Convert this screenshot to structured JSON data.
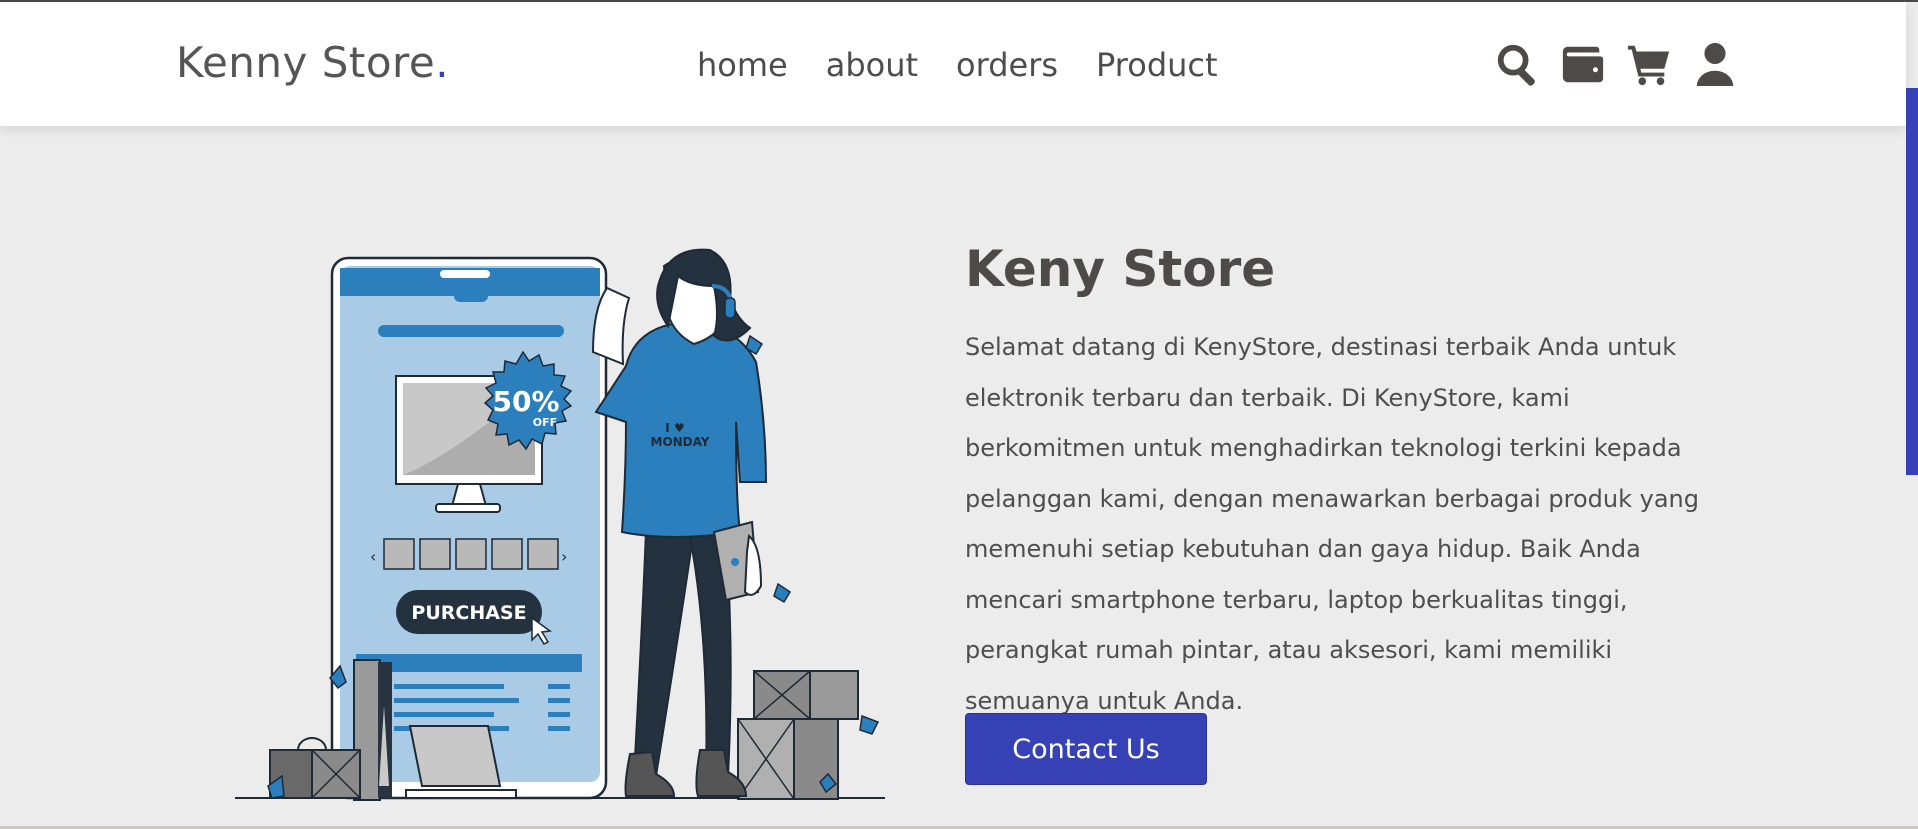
{
  "nav": {
    "logo_text": "Kenny Store",
    "logo_dot": ".",
    "links": [
      "home",
      "about",
      "orders",
      "Product"
    ],
    "icons": [
      "search-icon",
      "wallet-icon",
      "cart-icon",
      "user-icon"
    ]
  },
  "hero": {
    "title": "Keny Store",
    "description": "Selamat datang di KenyStore, destinasi terbaik Anda untuk elektronik terbaru dan terbaik. Di KenyStore, kami berkomitmen untuk menghadirkan teknologi terkini kepada pelanggan kami, dengan menawarkan berbagai produk yang memenuhi setiap kebutuhan dan gaya hidup. Baik Anda mencari smartphone terbaru, laptop berkualitas tinggi, perangkat rumah pintar, atau aksesori, kami memiliki semuanya untuk Anda.",
    "cta_label": "Contact Us"
  },
  "illustration": {
    "badge_percent": "50%",
    "badge_off": "OFF",
    "purchase_label": "PURCHASE",
    "shirt_line1": "I ♥",
    "shirt_line2": "MONDAY"
  },
  "colors": {
    "accent": "#3541b4",
    "illustration_blue": "#2b7fbc",
    "text": "#4e4a4a",
    "background": "#ececec"
  }
}
